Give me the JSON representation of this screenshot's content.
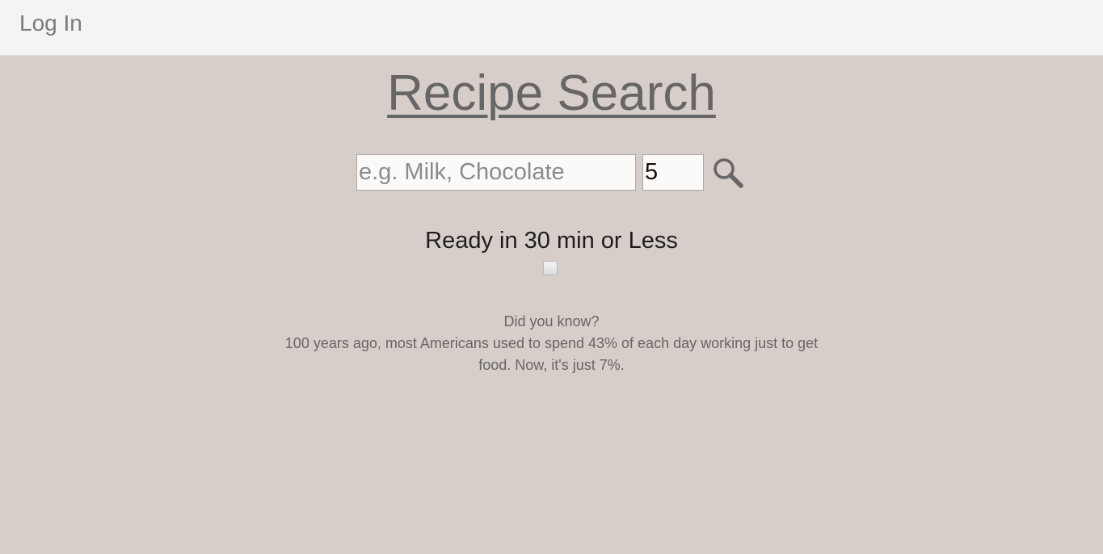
{
  "header": {
    "login_label": "Log In"
  },
  "main": {
    "title": "Recipe Search",
    "search": {
      "ingredients_placeholder": "e.g. Milk, Chocolate",
      "ingredients_value": "",
      "count_value": "5",
      "search_icon": "search-icon"
    },
    "filter": {
      "ready_label": "Ready in 30 min or Less",
      "ready_checked": false
    },
    "fact": {
      "heading": "Did you know?",
      "body": "100 years ago, most Americans used to spend 43% of each day working just to get food. Now, it's just 7%."
    }
  },
  "colors": {
    "page_background": "#d8cec9",
    "topbar_background": "#f4f4f4",
    "title_color": "#666666",
    "text_dark": "#1e1e1e",
    "text_muted": "#666666"
  }
}
